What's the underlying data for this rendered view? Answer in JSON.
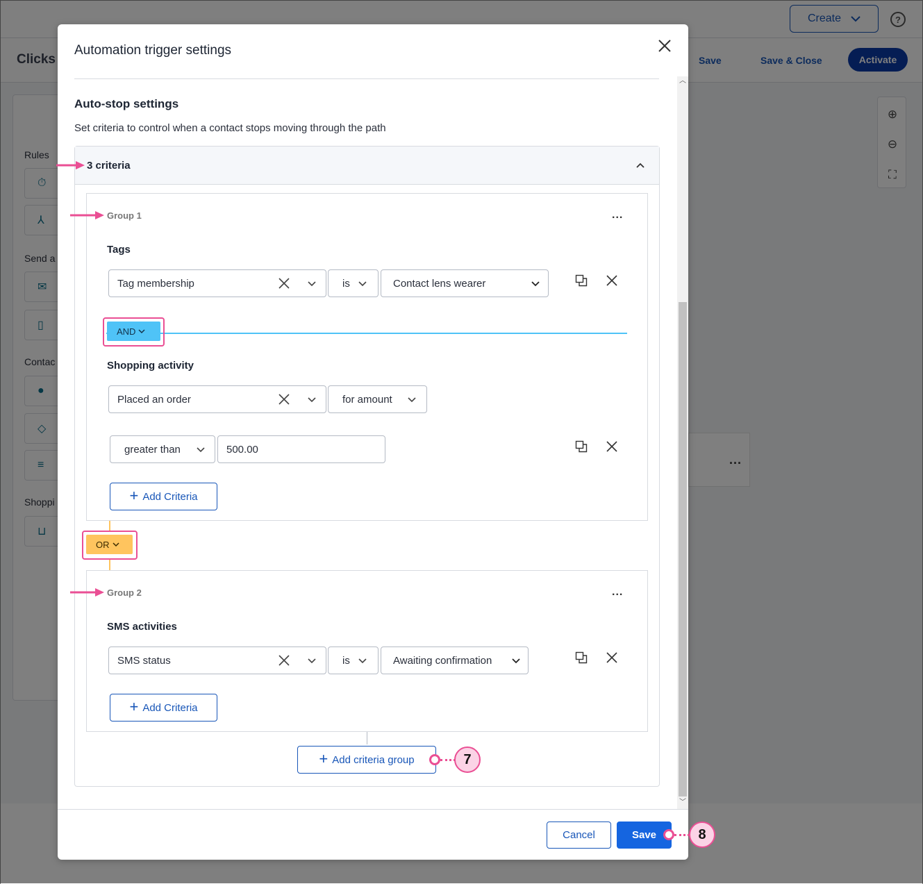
{
  "app": {
    "create_label": "Create",
    "help_glyph": "?",
    "page_title": "Clicks t",
    "save_label": "Save",
    "save_close_label": "Save & Close",
    "activate_label": "Activate",
    "left_panel": {
      "rules_heading": "Rules",
      "send_heading": "Send a",
      "contact_heading": "Contac",
      "shopping_heading": "Shoppi"
    },
    "card_menu": "..."
  },
  "modal": {
    "title": "Automation trigger settings",
    "section_title": "Auto-stop settings",
    "section_description": "Set criteria to control when a contact stops moving through the path",
    "criteria_count": "3 criteria",
    "group1": {
      "label": "Group 1",
      "menu": "...",
      "tags_label": "Tags",
      "tag_field": "Tag membership",
      "tag_operator": "is",
      "tag_value": "Contact lens wearer",
      "and_label": "AND",
      "shopping_label": "Shopping activity",
      "shopping_field": "Placed an order",
      "shopping_qualifier": "for amount",
      "comparison": "greater than",
      "amount": "500.00",
      "add_criteria": "Add Criteria"
    },
    "or_label": "OR",
    "group2": {
      "label": "Group 2",
      "menu": "...",
      "sms_label": "SMS activities",
      "sms_field": "SMS status",
      "sms_operator": "is",
      "sms_value": "Awaiting confirmation",
      "add_criteria": "Add Criteria"
    },
    "add_group": "Add criteria group",
    "cancel_label": "Cancel",
    "save_label": "Save"
  },
  "annotations": {
    "step7": "7",
    "step8": "8"
  },
  "colors": {
    "accent": "#1856b8",
    "and": "#4fc3f7",
    "or": "#ffc45e",
    "highlight": "#ea4f94"
  }
}
